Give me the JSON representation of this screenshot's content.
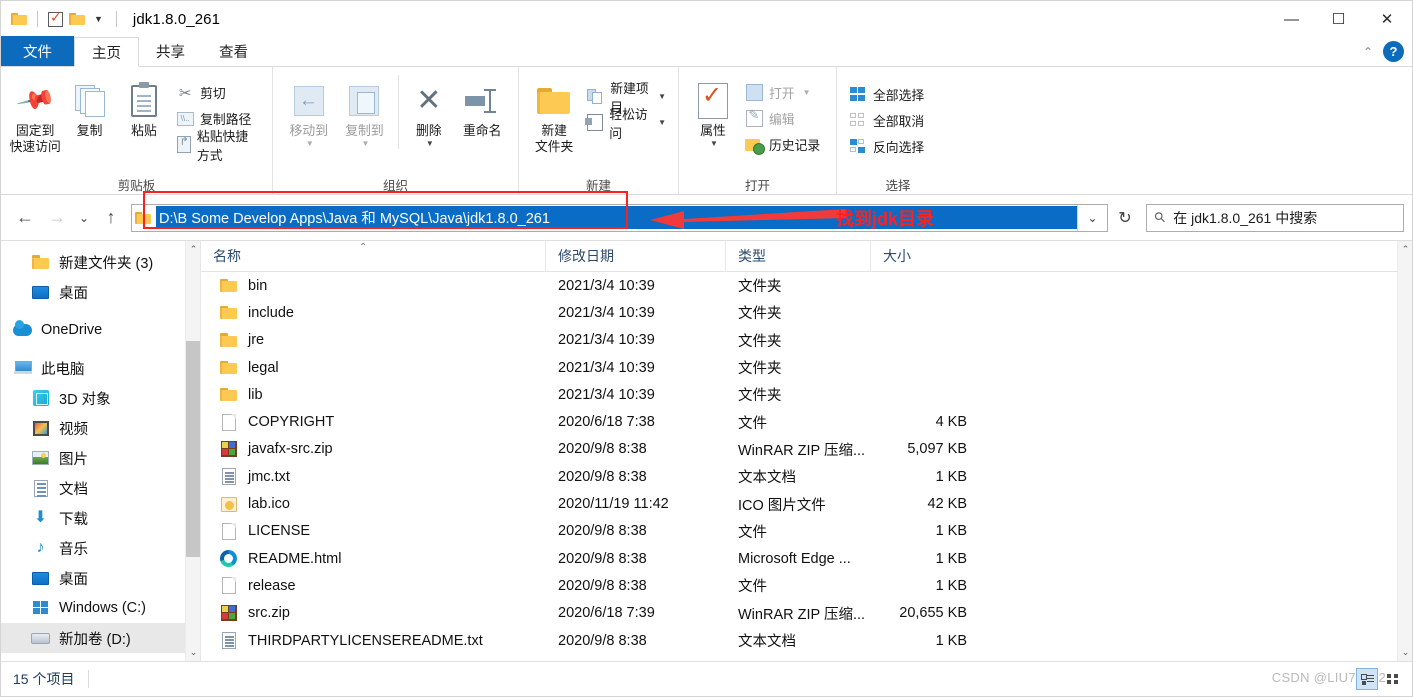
{
  "window": {
    "title": "jdk1.8.0_261",
    "quick_access": [
      "folder-icon",
      "checkbox-icon",
      "folder-icon"
    ],
    "controls": {
      "minimize": "—",
      "maximize": "☐",
      "close": "✕"
    }
  },
  "ribbon": {
    "tabs": [
      {
        "label": "文件",
        "type": "file"
      },
      {
        "label": "主页",
        "type": "active"
      },
      {
        "label": "共享",
        "type": "normal"
      },
      {
        "label": "查看",
        "type": "normal"
      }
    ],
    "collapse_icon": "chevron-up-icon",
    "help_label": "?",
    "groups": [
      {
        "name": "剪贴板",
        "big": [
          {
            "line1": "固定到",
            "line2": "快速访问",
            "icon": "pin-icon"
          },
          {
            "line1": "复制",
            "line2": "",
            "icon": "copy-icon"
          },
          {
            "line1": "粘贴",
            "line2": "",
            "icon": "paste-icon"
          }
        ],
        "small": [
          {
            "label": "剪切",
            "icon": "scissors-icon"
          },
          {
            "label": "复制路径",
            "icon": "copy-path-icon"
          },
          {
            "label": "粘贴快捷方式",
            "icon": "paste-shortcut-icon"
          }
        ]
      },
      {
        "name": "组织",
        "big": [
          {
            "line1": "移动到",
            "line2": "",
            "icon": "move-to-icon",
            "dim": true,
            "caret": true
          },
          {
            "line1": "复制到",
            "line2": "",
            "icon": "copy-to-icon",
            "dim": true,
            "caret": true
          },
          {
            "line1": "删除",
            "line2": "",
            "icon": "delete-icon",
            "caret": true
          },
          {
            "line1": "重命名",
            "line2": "",
            "icon": "rename-icon"
          }
        ],
        "small": []
      },
      {
        "name": "新建",
        "big": [
          {
            "line1": "新建",
            "line2": "文件夹",
            "icon": "new-folder-icon"
          }
        ],
        "small": [
          {
            "label": "新建项目",
            "icon": "new-item-icon",
            "caret": true
          },
          {
            "label": "轻松访问",
            "icon": "easy-access-icon",
            "caret": true
          }
        ]
      },
      {
        "name": "打开",
        "big": [
          {
            "line1": "属性",
            "line2": "",
            "icon": "properties-icon",
            "caret": true
          }
        ],
        "small": [
          {
            "label": "打开",
            "icon": "open-icon",
            "dim": true,
            "caret": true
          },
          {
            "label": "编辑",
            "icon": "edit-icon",
            "dim": true
          },
          {
            "label": "历史记录",
            "icon": "history-icon"
          }
        ]
      },
      {
        "name": "选择",
        "big": [],
        "small": [
          {
            "label": "全部选择",
            "icon": "select-all-icon"
          },
          {
            "label": "全部取消",
            "icon": "select-none-icon"
          },
          {
            "label": "反向选择",
            "icon": "invert-selection-icon"
          }
        ]
      }
    ]
  },
  "addressbar": {
    "back_icon": "back-arrow-icon",
    "forward_icon": "forward-arrow-icon",
    "recent_icon": "chevron-down-icon",
    "up_icon": "up-arrow-icon",
    "path_value": "D:\\B  Some Develop  Apps\\Java 和 MySQL\\Java\\jdk1.8.0_261",
    "dropdown_icon": "chevron-down-icon",
    "refresh_icon": "refresh-icon",
    "search_icon": "search-icon",
    "search_placeholder": "在 jdk1.8.0_261 中搜索"
  },
  "annotation": {
    "text": "找到jdk目录",
    "color": "#ff2020",
    "arrow": "left-arrow-icon"
  },
  "sidebar": {
    "items": [
      {
        "label": "新建文件夹 (3)",
        "icon": "folder-icon",
        "indent": "child",
        "selected": false
      },
      {
        "label": "桌面",
        "icon": "desktop-icon",
        "indent": "child",
        "selected": false
      },
      {
        "label": "OneDrive",
        "icon": "onedrive-icon",
        "indent": "root",
        "selected": false
      },
      {
        "label": "此电脑",
        "icon": "this-pc-icon",
        "indent": "root",
        "selected": false
      },
      {
        "label": "3D 对象",
        "icon": "3d-objects-icon",
        "indent": "child",
        "selected": false
      },
      {
        "label": "视频",
        "icon": "videos-icon",
        "indent": "child",
        "selected": false
      },
      {
        "label": "图片",
        "icon": "pictures-icon",
        "indent": "child",
        "selected": false
      },
      {
        "label": "文档",
        "icon": "documents-icon",
        "indent": "child",
        "selected": false
      },
      {
        "label": "下载",
        "icon": "downloads-icon",
        "indent": "child",
        "selected": false
      },
      {
        "label": "音乐",
        "icon": "music-icon",
        "indent": "child",
        "selected": false
      },
      {
        "label": "桌面",
        "icon": "desktop-icon",
        "indent": "child",
        "selected": false
      },
      {
        "label": "Windows (C:)",
        "icon": "windows-drive-icon",
        "indent": "child",
        "selected": false
      },
      {
        "label": "新加卷 (D:)",
        "icon": "drive-icon",
        "indent": "child",
        "selected": true
      }
    ]
  },
  "filelist": {
    "columns": [
      "名称",
      "修改日期",
      "类型",
      "大小"
    ],
    "sort_indicator": "ascending",
    "rows": [
      {
        "name": "bin",
        "date": "2021/3/4 10:39",
        "type": "文件夹",
        "size": "",
        "icon": "folder-icon"
      },
      {
        "name": "include",
        "date": "2021/3/4 10:39",
        "type": "文件夹",
        "size": "",
        "icon": "folder-icon"
      },
      {
        "name": "jre",
        "date": "2021/3/4 10:39",
        "type": "文件夹",
        "size": "",
        "icon": "folder-icon"
      },
      {
        "name": "legal",
        "date": "2021/3/4 10:39",
        "type": "文件夹",
        "size": "",
        "icon": "folder-icon"
      },
      {
        "name": "lib",
        "date": "2021/3/4 10:39",
        "type": "文件夹",
        "size": "",
        "icon": "folder-icon"
      },
      {
        "name": "COPYRIGHT",
        "date": "2020/6/18 7:38",
        "type": "文件",
        "size": "4 KB",
        "icon": "generic-file-icon"
      },
      {
        "name": "javafx-src.zip",
        "date": "2020/9/8 8:38",
        "type": "WinRAR ZIP 压缩...",
        "size": "5,097 KB",
        "icon": "zip-icon"
      },
      {
        "name": "jmc.txt",
        "date": "2020/9/8 8:38",
        "type": "文本文档",
        "size": "1 KB",
        "icon": "text-file-icon"
      },
      {
        "name": "lab.ico",
        "date": "2020/11/19 11:42",
        "type": "ICO 图片文件",
        "size": "42 KB",
        "icon": "ico-file-icon"
      },
      {
        "name": "LICENSE",
        "date": "2020/9/8 8:38",
        "type": "文件",
        "size": "1 KB",
        "icon": "generic-file-icon"
      },
      {
        "name": "README.html",
        "date": "2020/9/8 8:38",
        "type": "Microsoft Edge ...",
        "size": "1 KB",
        "icon": "edge-icon"
      },
      {
        "name": "release",
        "date": "2020/9/8 8:38",
        "type": "文件",
        "size": "1 KB",
        "icon": "generic-file-icon"
      },
      {
        "name": "src.zip",
        "date": "2020/6/18 7:39",
        "type": "WinRAR ZIP 压缩...",
        "size": "20,655 KB",
        "icon": "zip-icon"
      },
      {
        "name": "THIRDPARTYLICENSEREADME.txt",
        "date": "2020/9/8 8:38",
        "type": "文本文档",
        "size": "1 KB",
        "icon": "text-file-icon"
      }
    ]
  },
  "statusbar": {
    "item_count": "15 个项目",
    "watermark": "CSDN @LIU77252",
    "view_details_icon": "details-view-icon",
    "view_icons_icon": "icons-view-icon"
  }
}
